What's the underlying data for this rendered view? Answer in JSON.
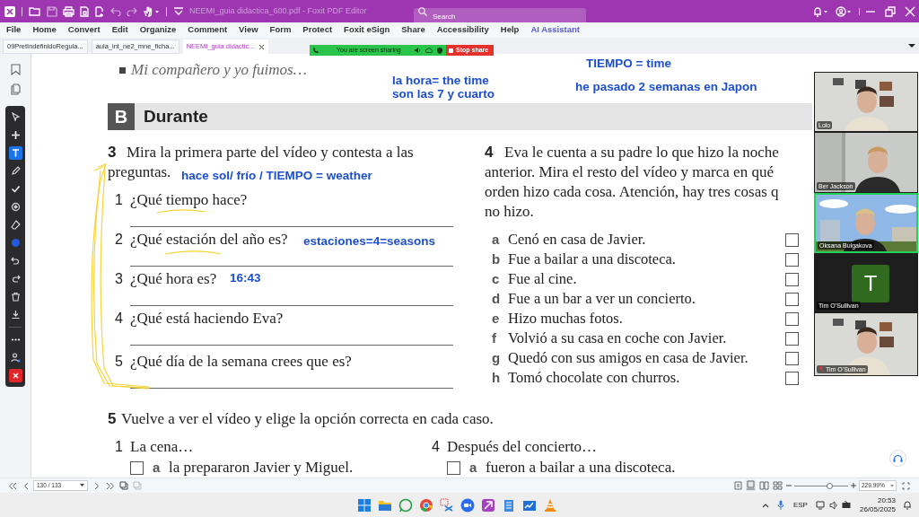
{
  "title_bar": {
    "title": "NEEMI_guia didactica_600.pdf - Foxit PDF Editor",
    "search_placeholder": "Search"
  },
  "menu": [
    {
      "label": "File",
      "kind": "menu"
    },
    {
      "label": "Home",
      "kind": "menu"
    },
    {
      "label": "Convert",
      "kind": "menu"
    },
    {
      "label": "Edit",
      "kind": "menu"
    },
    {
      "label": "Organize",
      "kind": "menu"
    },
    {
      "label": "Comment",
      "kind": "menu"
    },
    {
      "label": "View",
      "kind": "menu"
    },
    {
      "label": "Form",
      "kind": "menu"
    },
    {
      "label": "Protect",
      "kind": "menu"
    },
    {
      "label": "Foxit eSign",
      "kind": "menu"
    },
    {
      "label": "Share",
      "kind": "menu"
    },
    {
      "label": "Accessibility",
      "kind": "menu"
    },
    {
      "label": "Help",
      "kind": "menu"
    },
    {
      "label": "AI Assistant",
      "kind": "assistant"
    }
  ],
  "tabs": [
    {
      "label": "09PretIndefinidoRegula...",
      "selected": false
    },
    {
      "label": "aula_int_ne2_mne_ficha...",
      "selected": false
    },
    {
      "label": "NEEMI_guia didactic...",
      "selected": true
    }
  ],
  "share_bar": {
    "message": "You are screen sharing",
    "stop_label": "Stop share"
  },
  "annotation_tools": [
    {
      "kind": "select",
      "selected": false
    },
    {
      "kind": "move",
      "selected": false
    },
    {
      "kind": "text",
      "selected": true
    },
    {
      "kind": "pen",
      "selected": false
    },
    {
      "kind": "check",
      "selected": false
    },
    {
      "kind": "stamp",
      "selected": false
    },
    {
      "kind": "eraser",
      "selected": false
    },
    {
      "kind": "color",
      "selected": false
    },
    {
      "kind": "undo",
      "selected": false
    },
    {
      "kind": "redo",
      "selected": false
    },
    {
      "kind": "delete",
      "selected": false
    },
    {
      "kind": "save",
      "selected": false
    },
    {
      "kind": "more",
      "selected": false
    },
    {
      "kind": "person",
      "selected": false
    },
    {
      "kind": "close",
      "selected": false
    }
  ],
  "document": {
    "intro_line": "Mi compañero y yo fuimos…",
    "section": {
      "letter": "B",
      "title": "Durante"
    },
    "exercise_3": {
      "number": "3",
      "instruction_lines": [
        "Mira la primera parte del vídeo y contesta a las",
        "preguntas."
      ],
      "questions": [
        {
          "number": "1",
          "text": "¿Qué tiempo hace?"
        },
        {
          "number": "2",
          "text": "¿Qué estación del año es?"
        },
        {
          "number": "3",
          "text": "¿Qué hora es?"
        },
        {
          "number": "4",
          "text": "¿Qué está haciendo Eva?"
        },
        {
          "number": "5",
          "text": "¿Qué día de la semana crees que es?"
        }
      ]
    },
    "exercise_4": {
      "number": "4",
      "instruction_lines": [
        "Eva le cuenta a su padre lo que hizo la noche",
        "anterior. Mira el resto del vídeo y marca en qué",
        "orden hizo cada cosa. Atención, hay tres cosas q",
        "no hizo."
      ],
      "items": [
        {
          "letter": "a",
          "text": "Cenó en casa de Javier.",
          "checked": false
        },
        {
          "letter": "b",
          "text": "Fue a bailar a una discoteca.",
          "checked": false
        },
        {
          "letter": "c",
          "text": "Fue al cine.",
          "checked": false
        },
        {
          "letter": "d",
          "text": "Fue a un bar a ver un concierto.",
          "checked": false
        },
        {
          "letter": "e",
          "text": "Hizo muchas fotos.",
          "checked": false
        },
        {
          "letter": "f",
          "text": "Volvió a su casa en coche con Javier.",
          "checked": false
        },
        {
          "letter": "g",
          "text": "Quedó con sus amigos en casa de Javier.",
          "checked": false
        },
        {
          "letter": "h",
          "text": "Tomó chocolate con churros.",
          "checked": false
        }
      ]
    },
    "exercise_5": {
      "number": "5",
      "instruction": "Vuelve a ver el vídeo y elige la opción correcta en cada caso.",
      "questions": [
        {
          "number": "1",
          "text": "La cena…",
          "options": [
            {
              "letter": "a",
              "text": "la prepararon Javier y Miguel.",
              "checked": false
            }
          ]
        },
        {
          "number": "4",
          "text": "Después del concierto…",
          "options": [
            {
              "letter": "a",
              "text": "fueron a bailar a una discoteca.",
              "checked": false
            }
          ]
        }
      ]
    }
  },
  "annotations": [
    {
      "text": "TIEMPO = time"
    },
    {
      "text": "la hora= the time"
    },
    {
      "text": "son las 7 y cuarto"
    },
    {
      "text": "he pasado 2 semanas en Japon"
    },
    {
      "text": "hace sol/ frío / TIEMPO = weather"
    },
    {
      "text": "estaciones=4=seasons"
    },
    {
      "text": "16:43"
    }
  ],
  "participants": [
    {
      "name": "Lolo",
      "kind": "video",
      "speaking": false,
      "muted": false
    },
    {
      "name": "Ber Jackson",
      "kind": "video",
      "speaking": false,
      "muted": false
    },
    {
      "name": "Oksana Bulgakova",
      "kind": "video",
      "speaking": true,
      "muted": false
    },
    {
      "name": "Tim O'Sullivan",
      "kind": "avatar",
      "initial": "T",
      "speaking": false,
      "muted": false
    },
    {
      "name": "Tim O'Sullivan",
      "kind": "video",
      "speaking": false,
      "muted": true
    }
  ],
  "page_nav": {
    "page": "130 / 133",
    "zoom": "229.99%",
    "level": 0.65
  },
  "taskbar": {
    "language": "ESP",
    "time": "20:53",
    "date": "26/05/2025"
  }
}
